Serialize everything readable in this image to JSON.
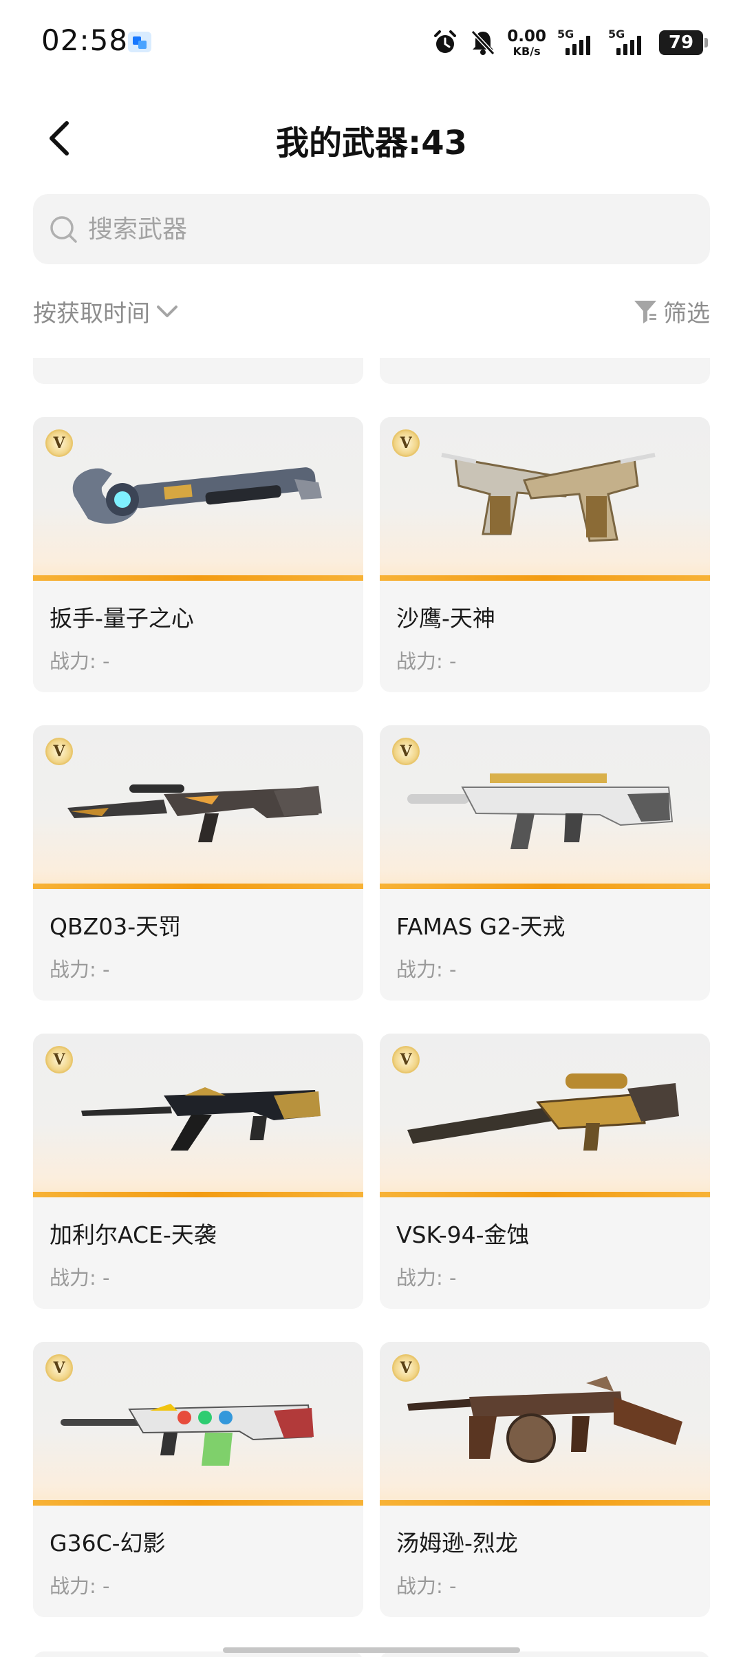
{
  "status_bar": {
    "time": "02:58",
    "net_speed_value": "0.00",
    "net_speed_unit": "KB/s",
    "sim1_tag": "5G",
    "sim2_tag": "5G",
    "battery": "79"
  },
  "header": {
    "title": "我的武器:43"
  },
  "search": {
    "placeholder": "搜索武器"
  },
  "controls": {
    "sort_label": "按获取时间",
    "filter_label": "筛选"
  },
  "weapons": [
    {
      "name": "扳手-量子之心",
      "power": "战力: -",
      "badge": "V",
      "art": "wrench"
    },
    {
      "name": "沙鹰-天神",
      "power": "战力: -",
      "badge": "V",
      "art": "dual-pistol"
    },
    {
      "name": "QBZ03-天罚",
      "power": "战力: -",
      "badge": "V",
      "art": "rifle-dark"
    },
    {
      "name": "FAMAS G2-天戎",
      "power": "战力: -",
      "badge": "V",
      "art": "rifle-white"
    },
    {
      "name": "加利尔ACE-天袭",
      "power": "战力: -",
      "badge": "V",
      "art": "rifle-black-gold"
    },
    {
      "name": "VSK-94-金蚀",
      "power": "战力: -",
      "badge": "V",
      "art": "rifle-gold"
    },
    {
      "name": "G36C-幻影",
      "power": "战力: -",
      "badge": "V",
      "art": "rifle-colorful"
    },
    {
      "name": "汤姆逊-烈龙",
      "power": "战力: -",
      "badge": "V",
      "art": "smg-dragon"
    }
  ],
  "colors": {
    "accent_orange": "#f39c12",
    "text_primary": "#1a1a1a",
    "text_secondary": "#9a9a9a",
    "card_bg": "#f5f5f5"
  }
}
